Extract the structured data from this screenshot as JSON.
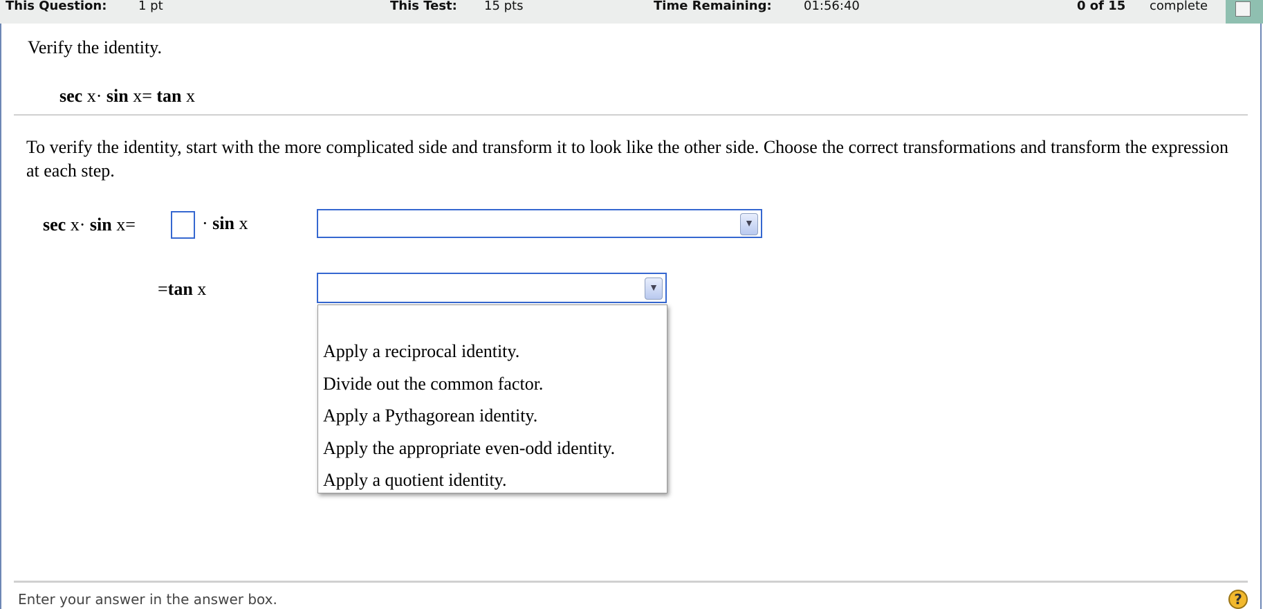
{
  "header": {
    "question_label": "This Question:",
    "question_value": "1 pt",
    "test_label": "This Test:",
    "test_value": "15 pts",
    "time_label": "Time Remaining:",
    "time_value": "01:56:40",
    "progress_count": "0 of 15",
    "progress_label": "complete"
  },
  "problem": {
    "instruction": "Verify the identity.",
    "identity": {
      "lhs1": "sec",
      "x1": "x",
      "dot": "·",
      "lhs2": "sin",
      "x2": "x",
      "eq": "=",
      "rhs": "tan",
      "x3": "x"
    }
  },
  "guidance": "To verify the identity, start with the more complicated side and transform it to look like the other side. Choose the correct transformations and transform the expression at each step.",
  "steps": [
    {
      "expr_pre": "sec",
      "x1": "x",
      "dot": "·",
      "f2": "sin",
      "x2": "x",
      "eq": "=",
      "after_dot": "·",
      "f3": "sin",
      "x3": "x",
      "box_value": "",
      "select_value": ""
    },
    {
      "eq": "=",
      "f": "tan",
      "x": "x",
      "select_value": ""
    }
  ],
  "dropdown_options": [
    "",
    "Apply a reciprocal identity.",
    "Divide out the common factor.",
    "Apply a Pythagorean identity.",
    "Apply the appropriate even-odd identity.",
    "Apply a quotient identity."
  ],
  "footer": {
    "hint": "Enter your answer in the answer box.",
    "help_icon": "?"
  }
}
